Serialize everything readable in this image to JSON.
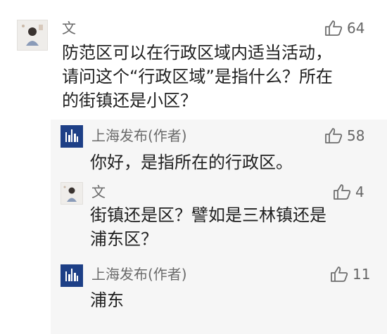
{
  "comments": [
    {
      "author": "文",
      "likes": "64",
      "lines": [
        "防范区可以在行政区域内适当活动，",
        "请问这个“行政区域”是指什么？所在",
        "的街镇还是小区？"
      ]
    }
  ],
  "replies": [
    {
      "author": "上海发布(作者)",
      "avatar_text": "上海发布",
      "likes": "58",
      "lines": [
        "你好，是指所在的行政区。"
      ]
    },
    {
      "author": "文",
      "likes": "4",
      "lines": [
        "街镇还是区？譬如是三林镇还是",
        "浦东区？"
      ]
    },
    {
      "author": "上海发布(作者)",
      "avatar_text": "上海发布",
      "likes": "11",
      "lines": [
        "浦东"
      ]
    }
  ],
  "icons": {
    "like": "thumbs-up-icon"
  },
  "colors": {
    "reply_bg": "#f6f6f6",
    "org_avatar": "#1d3f86"
  }
}
